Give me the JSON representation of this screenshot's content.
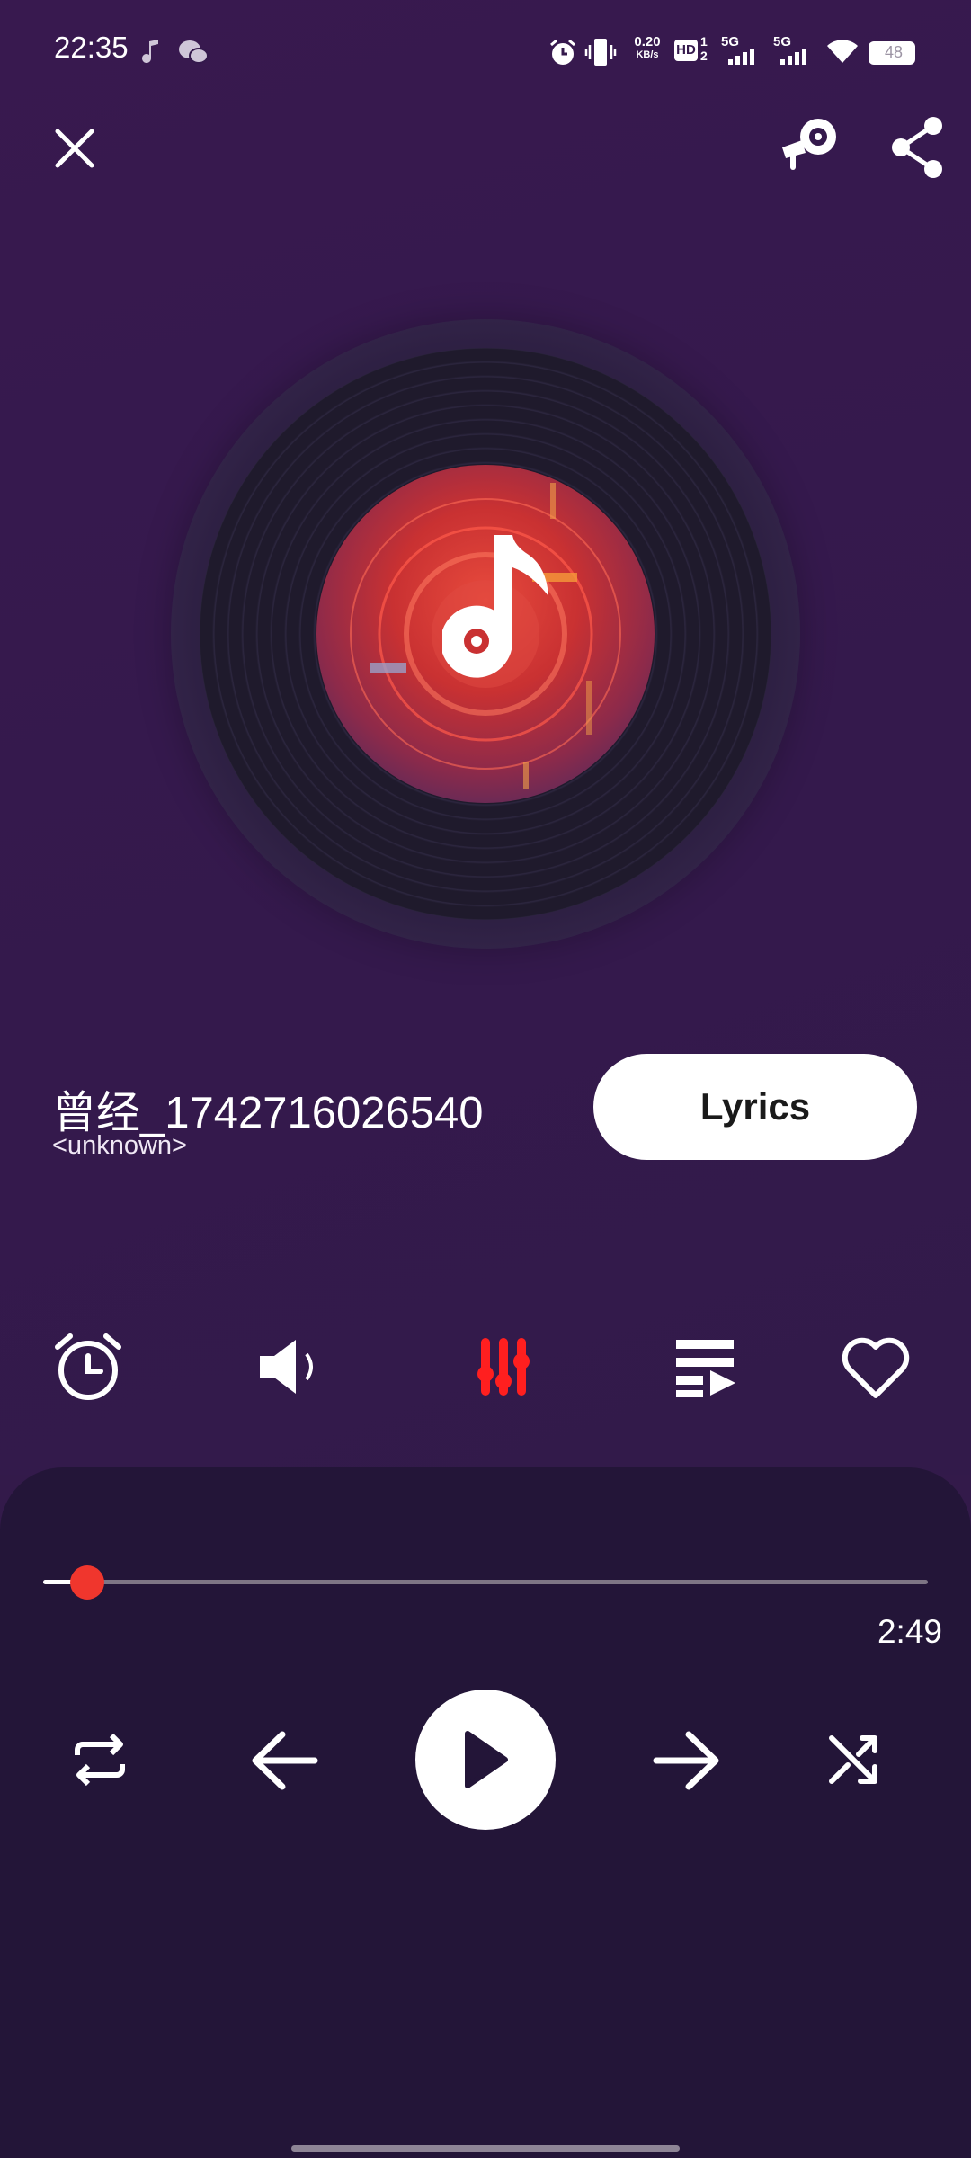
{
  "status_bar": {
    "time": "22:35",
    "net_speed_value": "0.20",
    "net_speed_unit": "KB/s",
    "hd_label": "HD",
    "sim1_label": "5G",
    "sim2_label": "5G",
    "battery": "48",
    "icons": [
      "music-note-icon",
      "wechat-icon",
      "alarm-icon",
      "vibrate-icon",
      "hd-icon",
      "signal-icon",
      "wifi-icon",
      "battery-icon"
    ]
  },
  "header": {
    "icons": [
      "close-icon",
      "cast-icon",
      "share-icon"
    ]
  },
  "track": {
    "title": "曾经_1742716026540",
    "artist": "<unknown>",
    "lyrics_label": "Lyrics"
  },
  "toolbar": {
    "icons": [
      "alarm-timer-icon",
      "volume-icon",
      "equalizer-icon",
      "queue-icon",
      "heart-icon"
    ],
    "active_color": "#ff1f1f"
  },
  "playback": {
    "duration": "2:49",
    "progress": 0.05,
    "icons": [
      "repeat-icon",
      "previous-icon",
      "play-icon",
      "next-icon",
      "shuffle-icon"
    ]
  },
  "colors": {
    "background": "#331a4a",
    "panel": "#231538",
    "accent": "#f0362d"
  }
}
